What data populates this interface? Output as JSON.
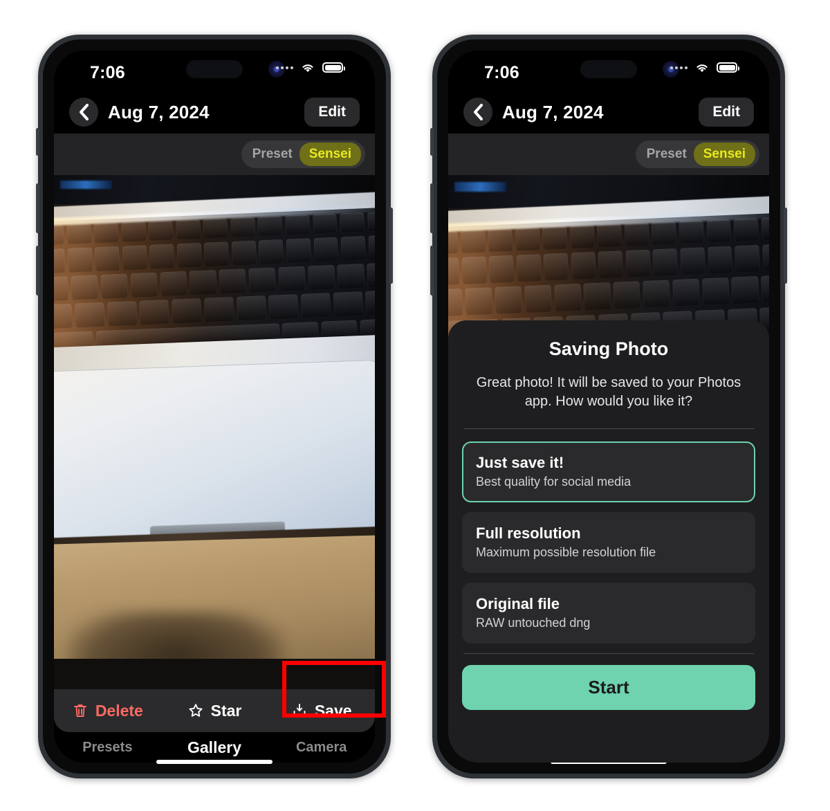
{
  "phones": [
    {
      "id": "phone-left",
      "status_bar": {
        "time": "7:06",
        "signal": "signal-dots-icon",
        "wifi": "wifi-icon",
        "battery": "battery-icon"
      },
      "nav": {
        "back": "chevron-left-icon",
        "title": "Aug 7, 2024",
        "edit_label": "Edit"
      },
      "preset": {
        "label": "Preset",
        "value": "Sensei"
      },
      "actions": [
        {
          "icon": "trash-icon",
          "label": "Delete",
          "color": "#fc6a63"
        },
        {
          "icon": "star-icon",
          "label": "Star",
          "color": "#ffffff"
        },
        {
          "icon": "save-download-icon",
          "label": "Save",
          "color": "#ffffff"
        }
      ],
      "tabs": [
        {
          "label": "Presets",
          "active": false
        },
        {
          "label": "Gallery",
          "active": true
        },
        {
          "label": "Camera",
          "active": false
        }
      ],
      "highlight": {
        "target": "save-button",
        "color": "#ff0000"
      }
    },
    {
      "id": "phone-right",
      "status_bar": {
        "time": "7:06",
        "signal": "signal-dots-icon",
        "wifi": "wifi-icon",
        "battery": "battery-icon"
      },
      "nav": {
        "back": "chevron-left-icon",
        "title": "Aug 7, 2024",
        "edit_label": "Edit"
      },
      "preset": {
        "label": "Preset",
        "value": "Sensei"
      },
      "modal": {
        "title": "Saving Photo",
        "subtitle": "Great photo! It will be saved to your Photos app. How would you like it?",
        "options": [
          {
            "title": "Just save it!",
            "desc": "Best quality for social media",
            "selected": true
          },
          {
            "title": "Full resolution",
            "desc": "Maximum possible resolution file",
            "selected": false
          },
          {
            "title": "Original file",
            "desc": "RAW untouched dng",
            "selected": false
          }
        ],
        "primary_label": "Start"
      }
    }
  ],
  "colors": {
    "accent_mint": "#6ed3ae",
    "preset_pill_bg": "#6f7017",
    "preset_pill_text": "#e9ea1f",
    "delete_red": "#fc6a63",
    "highlight_red": "#ff0000",
    "sheet_bg": "#1e1e20",
    "option_bg": "#2a2a2c"
  }
}
